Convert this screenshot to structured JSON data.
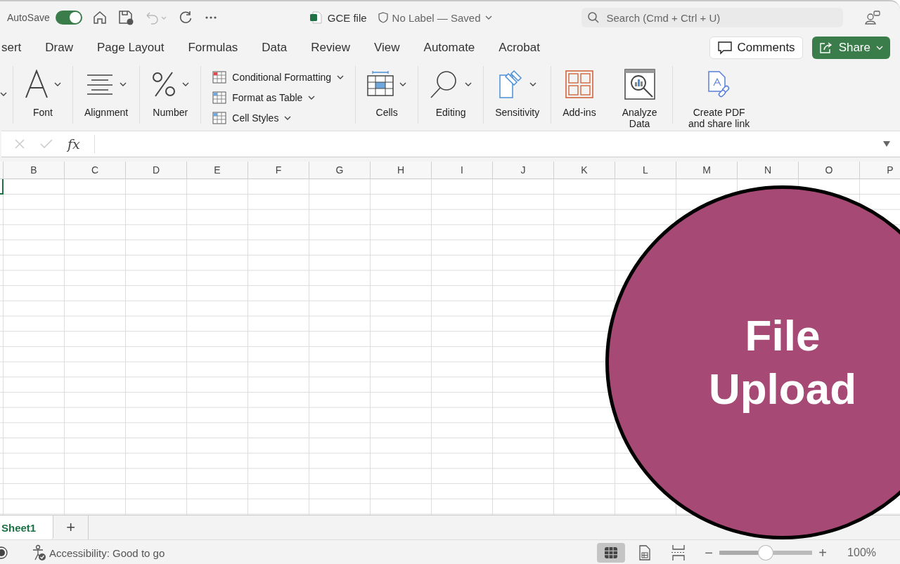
{
  "title_bar": {
    "autosave_label": "AutoSave",
    "autosave_on": true,
    "file_name": "GCE file",
    "label_status": "No Label — Saved",
    "search": {
      "placeholder": "Search (Cmd + Ctrl + U)"
    }
  },
  "ribbon_tabs": [
    {
      "label": "sert",
      "selected": false
    },
    {
      "label": "Draw",
      "selected": false
    },
    {
      "label": "Page Layout",
      "selected": false
    },
    {
      "label": "Formulas",
      "selected": false
    },
    {
      "label": "Data",
      "selected": false
    },
    {
      "label": "Review",
      "selected": false
    },
    {
      "label": "View",
      "selected": false
    },
    {
      "label": "Automate",
      "selected": false
    },
    {
      "label": "Acrobat",
      "selected": false
    }
  ],
  "header_buttons": {
    "comments": "Comments",
    "share": "Share"
  },
  "ribbon_groups": [
    {
      "kind": "font",
      "label": "Font"
    },
    {
      "kind": "alignment",
      "label": "Alignment"
    },
    {
      "kind": "number",
      "label": "Number"
    },
    {
      "kind": "styles",
      "items": [
        "Conditional Formatting",
        "Format as Table",
        "Cell Styles"
      ]
    },
    {
      "kind": "cells",
      "label": "Cells"
    },
    {
      "kind": "editing",
      "label": "Editing"
    },
    {
      "kind": "sensitivity",
      "label": "Sensitivity"
    },
    {
      "kind": "addins",
      "label": "Add-ins"
    },
    {
      "kind": "analyze",
      "label": "Analyze Data"
    },
    {
      "kind": "pdf",
      "label": "Create PDF and share link"
    }
  ],
  "formula_bar": {
    "fx": "fx"
  },
  "columns": [
    "B",
    "C",
    "D",
    "E",
    "F",
    "G",
    "H",
    "I",
    "J",
    "K",
    "L",
    "M",
    "N",
    "O",
    "P"
  ],
  "sheet_tabs": [
    {
      "label": "Sheet1",
      "selected": true
    }
  ],
  "add_sheet": "+",
  "status_bar": {
    "accessibility": "Accessibility: Good to go",
    "views": [
      {
        "kind": "normal",
        "selected": true
      },
      {
        "kind": "page",
        "selected": false
      },
      {
        "kind": "break",
        "selected": false
      }
    ],
    "zoom": {
      "level": 0.5,
      "reading": "100%",
      "minus": "−",
      "plus": "+"
    }
  },
  "overlay": {
    "text": "File Upload"
  }
}
